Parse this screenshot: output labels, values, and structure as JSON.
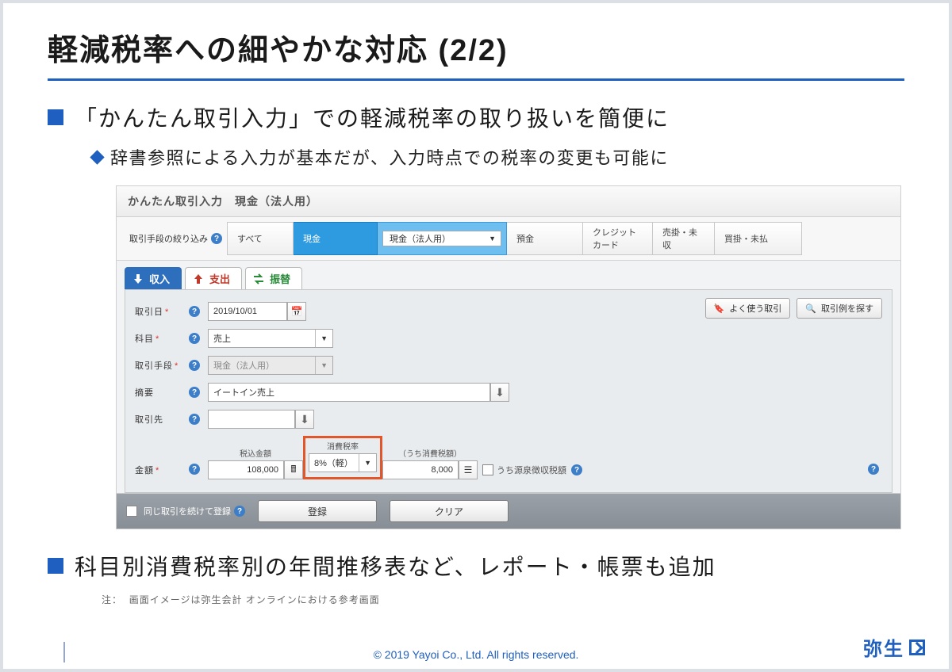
{
  "slide": {
    "title": "軽減税率への細やかな対応 (2/2)",
    "bullet1": "「かんたん取引入力」での軽減税率の取り扱いを簡便に",
    "bullet1_sub": "辞書参照による入力が基本だが、入力時点での税率の変更も可能に",
    "bullet2": "科目別消費税率別の年間推移表など、レポート・帳票も追加",
    "note_prefix": "注：",
    "note": "画面イメージは弥生会計 オンラインにおける参考画面",
    "copyright": "© 2019 Yayoi Co., Ltd.  All rights reserved.",
    "brand": "弥生"
  },
  "app": {
    "window_title": "かんたん取引入力　現金（法人用）",
    "filter": {
      "label": "取引手段の絞り込み",
      "segments": [
        "すべて",
        "現金",
        "現金（法人用）",
        "預金",
        "クレジットカード",
        "売掛・未収",
        "買掛・未払"
      ]
    },
    "tabs": {
      "income": "収入",
      "expense": "支出",
      "transfer": "振替"
    },
    "buttons": {
      "frequent": "よく使う取引",
      "search": "取引例を探す",
      "register": "登録",
      "clear": "クリア",
      "continue": "同じ取引を続けて登録"
    },
    "form": {
      "date_label": "取引日",
      "date_value": "2019/10/01",
      "account_label": "科目",
      "account_value": "売上",
      "method_label": "取引手段",
      "method_value": "現金（法人用）",
      "summary_label": "摘要",
      "summary_value": "イートイン売上",
      "partner_label": "取引先",
      "amount_label": "金額",
      "incl_label": "税込金額",
      "incl_value": "108,000",
      "rate_label": "消費税率",
      "rate_value": "8%（軽）",
      "tax_paren_label": "（うち消費税額）",
      "tax_value": "8,000",
      "withholding_label": "うち源泉徴収税額"
    }
  }
}
